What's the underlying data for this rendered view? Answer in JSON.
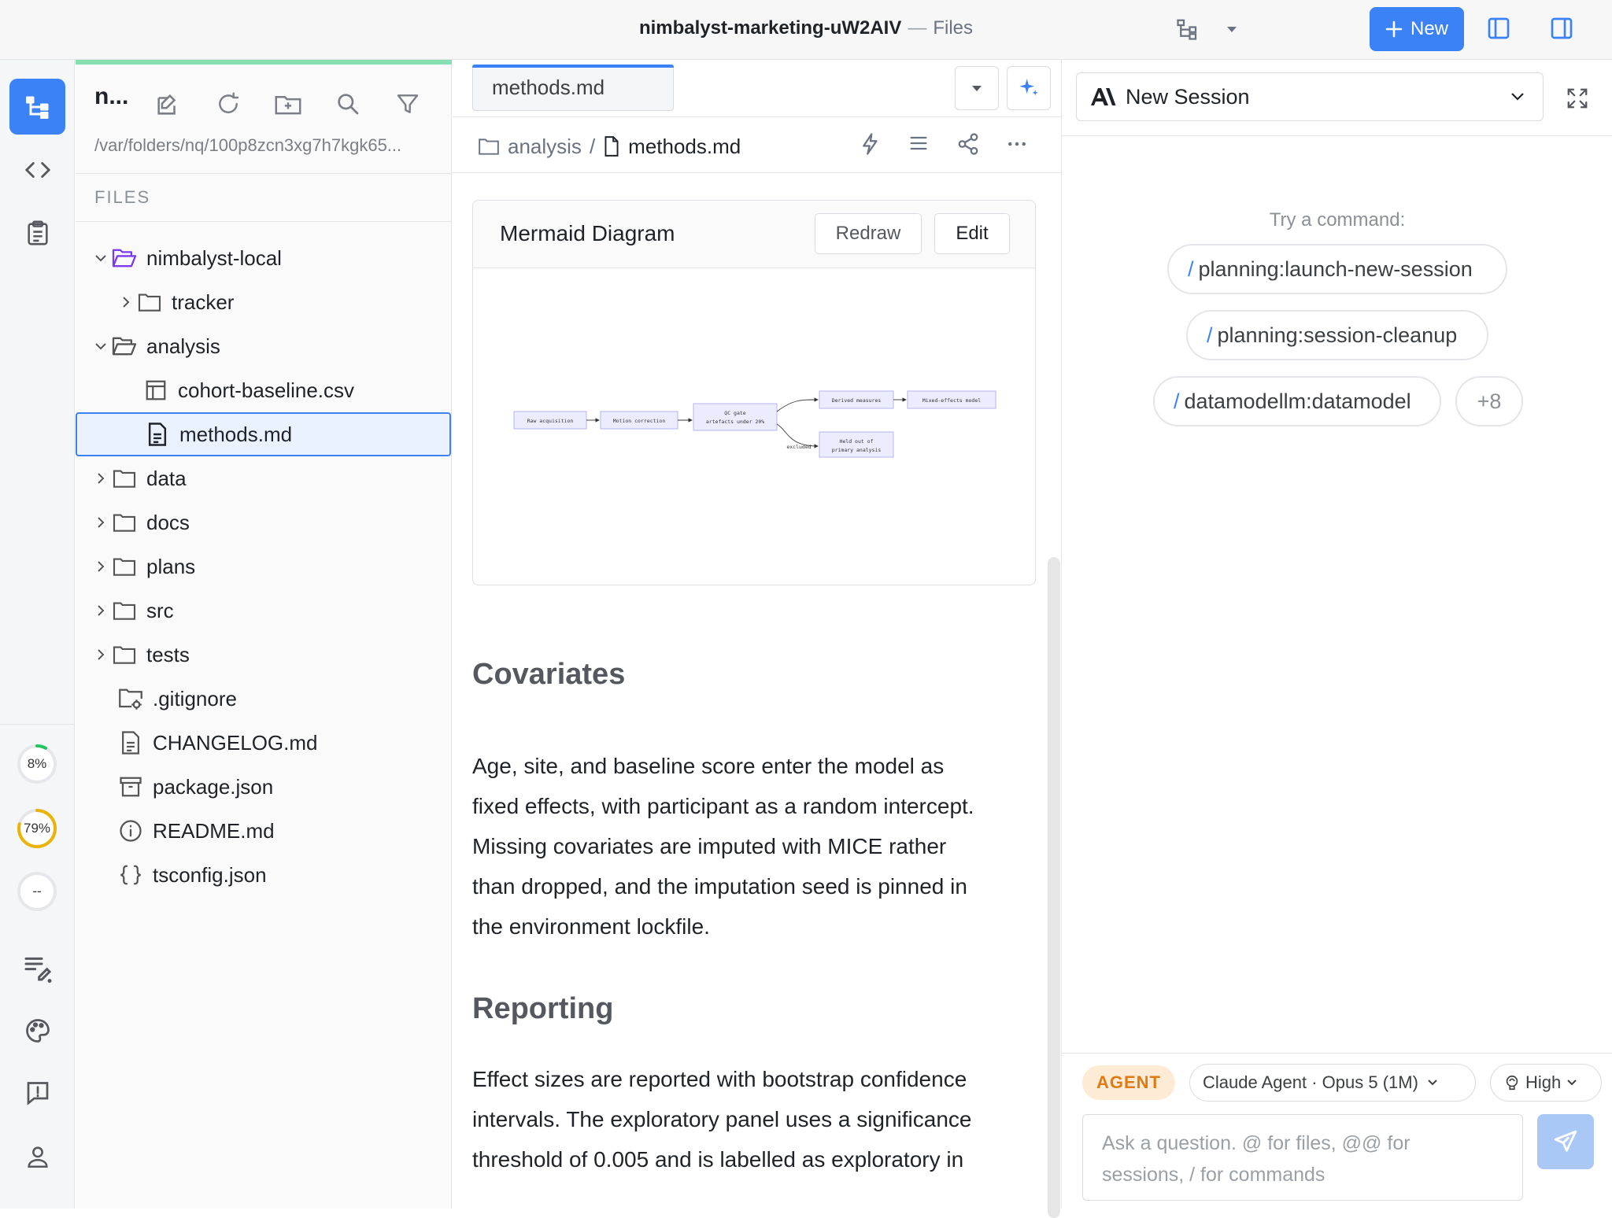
{
  "window": {
    "title": "nimbalyst-marketing-uW2AIV",
    "separator": "—",
    "subtitle": "Files",
    "new_button_label": "New"
  },
  "rail": {
    "usage": [
      {
        "label": "8%",
        "percent": 8,
        "color": "#22c55e"
      },
      {
        "label": "79%",
        "percent": 79,
        "color": "#eab308"
      },
      {
        "label": "--",
        "percent": 0,
        "color": "#d1d5db"
      }
    ]
  },
  "filetree": {
    "workspace_name": "n...",
    "path": "/var/folders/nq/100p8zcn3xg7h7kgk65...",
    "section_label": "FILES",
    "items": [
      {
        "label": "nimbalyst-local",
        "icon": "folder-open-icon"
      },
      {
        "label": "tracker",
        "icon": "folder-icon"
      },
      {
        "label": "analysis",
        "icon": "folder-open-icon"
      },
      {
        "label": "cohort-baseline.csv",
        "icon": "table-icon"
      },
      {
        "label": "methods.md",
        "icon": "file-text-icon"
      },
      {
        "label": "data",
        "icon": "folder-icon"
      },
      {
        "label": "docs",
        "icon": "folder-icon"
      },
      {
        "label": "plans",
        "icon": "folder-icon"
      },
      {
        "label": "src",
        "icon": "folder-icon"
      },
      {
        "label": "tests",
        "icon": "folder-icon"
      },
      {
        "label": ".gitignore",
        "icon": "folder-gear-icon"
      },
      {
        "label": "CHANGELOG.md",
        "icon": "file-text-icon"
      },
      {
        "label": "package.json",
        "icon": "package-icon"
      },
      {
        "label": "README.md",
        "icon": "info-icon"
      },
      {
        "label": "tsconfig.json",
        "icon": "braces-icon"
      }
    ]
  },
  "editor": {
    "tab_label": "methods.md",
    "breadcrumb": {
      "folder": "analysis",
      "separator": "/",
      "file": "methods.md"
    },
    "mermaid": {
      "title": "Mermaid Diagram",
      "redraw_label": "Redraw",
      "edit_label": "Edit",
      "nodes": {
        "n1": "Raw acquisition",
        "n2": "Motion correction",
        "n3a": "QC gate",
        "n3b": "artefacts under 20%",
        "n4": "Derived measures",
        "n5": "Mixed-effects model",
        "n6a": "Held out of",
        "n6b": "primary analysis",
        "edge_label": "excluded"
      }
    },
    "sections": [
      {
        "heading": "Covariates",
        "lines": [
          "Age, site, and baseline score enter the model as",
          "fixed effects, with participant as a random intercept.",
          "Missing covariates are imputed with MICE rather",
          "than dropped, and the imputation seed is pinned in",
          "the environment lockfile."
        ]
      },
      {
        "heading": "Reporting",
        "lines": [
          "Effect sizes are reported with bootstrap confidence",
          "intervals. The exploratory panel uses a significance",
          "threshold of 0.005 and is labelled as exploratory in"
        ]
      }
    ]
  },
  "agent_panel": {
    "session_label": "New Session",
    "try_label": "Try a command:",
    "commands": [
      "planning:launch-new-session",
      "planning:session-cleanup",
      "datamodellm:datamodel"
    ],
    "slash": "/",
    "more_label": "+8",
    "mode_badge": "AGENT",
    "model_label": "Claude Agent · Opus 5 (1M)",
    "effort_label": "High",
    "input_placeholder_line1": "Ask a question. @ for files, @@ for",
    "input_placeholder_line2": "sessions, / for commands"
  }
}
